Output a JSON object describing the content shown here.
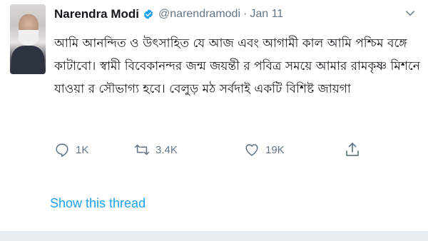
{
  "tweet": {
    "author_name": "Narendra Modi",
    "handle": "@narendramodi",
    "separator": "·",
    "date": "Jan 11",
    "text": "আমি আনন্দিত ও উৎসাহিত যে  আজ এবং আগামী কাল আমি পশ্চিম বঙ্গে\nকাটাবো। স্বামী বিবেকানন্দর জন্ম জয়ন্তী র পবিত্র সময়ে আমার রামকৃষ্ণ মিশনে\nযাওয়া র সৌভাগ্য হবে। বেলুড় মঠ সর্বদাই একটি বিশিষ্ট জায়গা",
    "actions": {
      "reply_count": "1K",
      "retweet_count": "3.4K",
      "like_count": "19K"
    },
    "show_thread_label": "Show this thread"
  },
  "icons": {
    "verified": "verified-badge-icon",
    "caret": "chevron-down-icon",
    "reply": "reply-icon",
    "retweet": "retweet-icon",
    "like": "heart-icon",
    "share": "share-icon"
  },
  "colors": {
    "accent": "#1da1f2",
    "muted": "#657786",
    "text": "#14171a"
  }
}
